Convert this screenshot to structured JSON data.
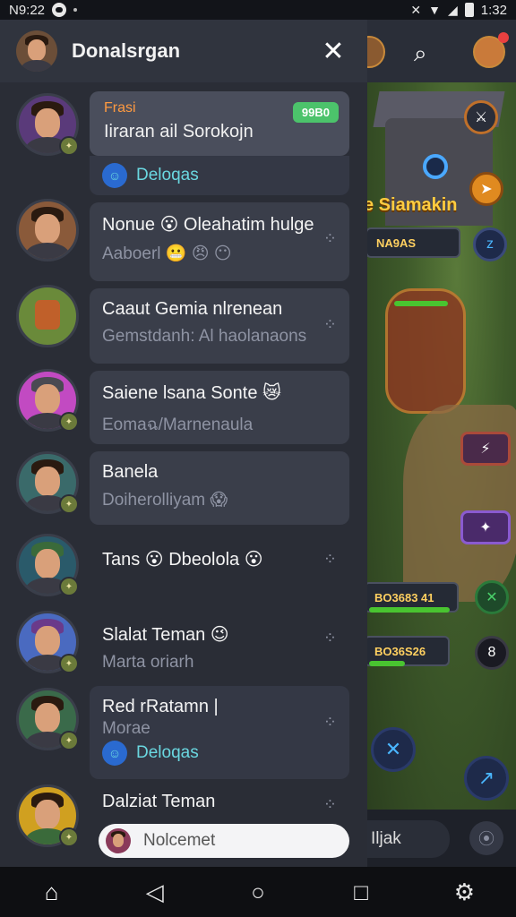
{
  "status_bar": {
    "time_left": "N9:22",
    "time_right": "1:32"
  },
  "drawer": {
    "title": "Donalsrgan",
    "close_icon": "close-icon",
    "highlight": {
      "tag": "Frasi",
      "message": "Iiraran ail Sorokojn",
      "time_badge": "99B0",
      "attachment": "Deloqas"
    },
    "chats": [
      {
        "name": "Nonue 😮 Oleahatim hulge",
        "message": "Aaboerl 😬 😠 😶"
      },
      {
        "name": "Caaut Gemia nlrenean",
        "message": "Gemstdanh: Al haolanaons"
      },
      {
        "name": "Saiene lsana Sonte 😿",
        "message": "Eomaฉ/Marnenaula"
      },
      {
        "name": "Banela",
        "message": "Doiherolliyam 😱"
      },
      {
        "name": "Tans 😮 Dbeolola 😮",
        "message": ""
      },
      {
        "name": "Slalat Teman 😉",
        "message": "Marta oriarh"
      },
      {
        "name": "Red rRatamn |",
        "message": "Morae",
        "attachment": "Deloqas"
      },
      {
        "name": "Dalziat Teman",
        "message": ""
      }
    ],
    "search_pill": "Nolcemet"
  },
  "game": {
    "title": "e Siamakin",
    "panel1": "NA9AS",
    "panel2": "BO3683 41",
    "panel3": "BO36S26",
    "say_text": "Iljak"
  },
  "nav": {
    "home_icon": "home-icon",
    "back_icon": "back-triangle-icon",
    "circle_icon": "home-circle-icon",
    "recents_icon": "recents-square-icon",
    "extra_icon": "game-controller-icon"
  }
}
